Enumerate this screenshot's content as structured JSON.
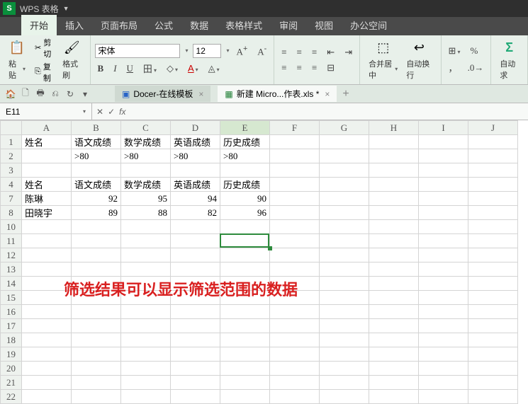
{
  "app": {
    "name": "WPS 表格"
  },
  "menus": [
    "开始",
    "插入",
    "页面布局",
    "公式",
    "数据",
    "表格样式",
    "审阅",
    "视图",
    "办公空间"
  ],
  "active_menu": 0,
  "clipboard": {
    "cut": "剪切",
    "copy": "复制",
    "paste": "粘贴",
    "format_painter": "格式刷"
  },
  "font": {
    "name": "宋体",
    "size": "12"
  },
  "align": {
    "merge": "合并居中",
    "wrap": "自动换行",
    "auto": "自动换行"
  },
  "right_section": {
    "label": "自动求"
  },
  "qat_icons": [
    "🏠",
    "🗋",
    "🖶",
    "⎌",
    "↻",
    "▾"
  ],
  "doc_tabs": [
    {
      "icon": "D",
      "label": "Docer-在线模板",
      "active": false
    },
    {
      "icon": "X",
      "label": "新建 Micro...作表.xls *",
      "active": true
    }
  ],
  "name_box": "E11",
  "columns": [
    "A",
    "B",
    "C",
    "D",
    "E",
    "F",
    "G",
    "H",
    "I",
    "J"
  ],
  "rows": [
    1,
    2,
    3,
    4,
    7,
    8,
    10,
    11,
    12,
    13,
    14,
    15,
    16,
    17,
    18,
    19,
    20,
    21,
    22
  ],
  "cells": {
    "A1": "姓名",
    "B1": "语文成绩",
    "C1": "数学成绩",
    "D1": "英语成绩",
    "E1": "历史成绩",
    "B2": ">80",
    "C2": ">80",
    "D2": ">80",
    "E2": ">80",
    "A4": "姓名",
    "B4": "语文成绩",
    "C4": "数学成绩",
    "D4": "英语成绩",
    "E4": "历史成绩",
    "A7": "陈琳",
    "B7": "92",
    "C7": "95",
    "D7": "94",
    "E7": "90",
    "A8": "田晓宇",
    "B8": "89",
    "C8": "88",
    "D8": "82",
    "E8": "96"
  },
  "annotation": "筛选结果可以显示筛选范围的数据",
  "active_cell": "E11",
  "chart_data": {
    "type": "table",
    "title": "筛选结果",
    "columns": [
      "姓名",
      "语文成绩",
      "数学成绩",
      "英语成绩",
      "历史成绩"
    ],
    "criteria": {
      "语文成绩": ">80",
      "数学成绩": ">80",
      "英语成绩": ">80",
      "历史成绩": ">80"
    },
    "rows": [
      {
        "姓名": "陈琳",
        "语文成绩": 92,
        "数学成绩": 95,
        "英语成绩": 94,
        "历史成绩": 90
      },
      {
        "姓名": "田晓宇",
        "语文成绩": 89,
        "数学成绩": 88,
        "英语成绩": 82,
        "历史成绩": 96
      }
    ]
  }
}
